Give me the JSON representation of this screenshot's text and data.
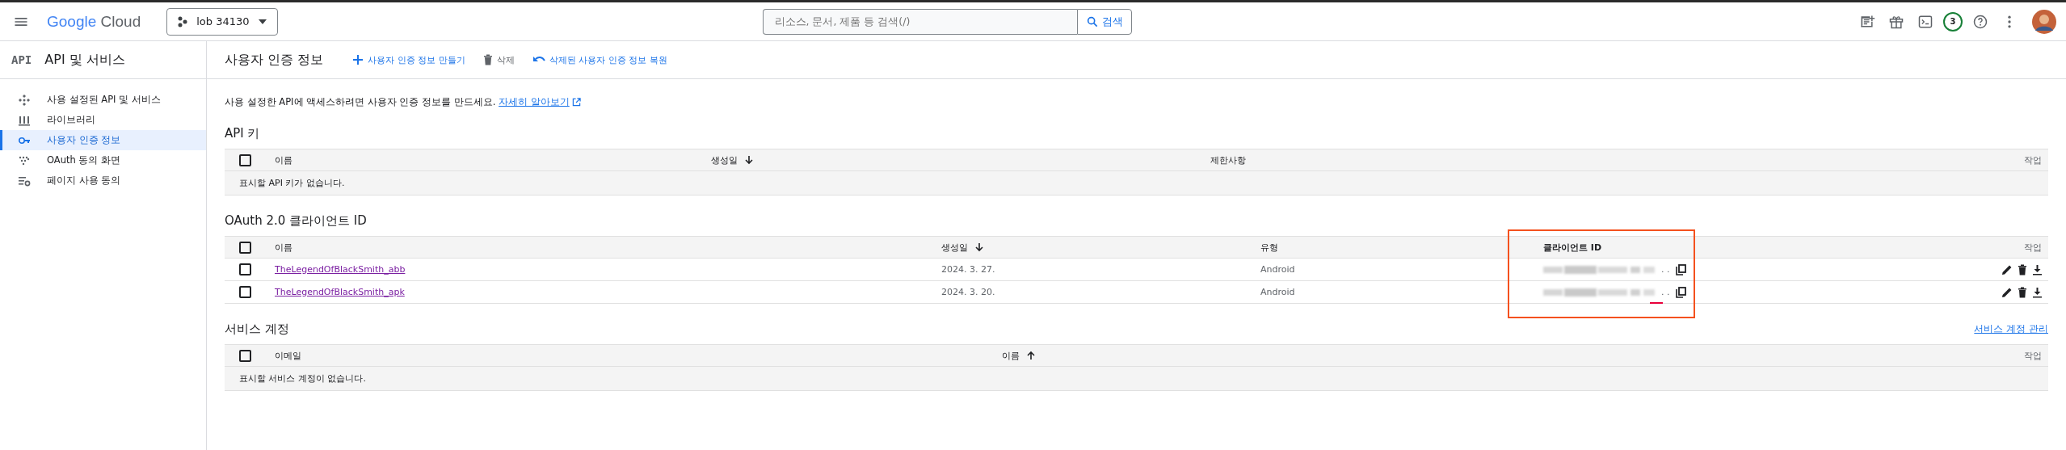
{
  "topbar": {
    "logo": {
      "brand": "Google",
      "product": "Cloud"
    },
    "project": "lob 34130",
    "search": {
      "placeholder": "리소스, 문서, 제품 등 검색(/)",
      "button": "검색"
    },
    "notifications": "3"
  },
  "sidebar": {
    "badge": "API",
    "title": "API 및 서비스",
    "items": [
      {
        "label": "사용 설정된 API 및 서비스",
        "selected": false
      },
      {
        "label": "라이브러리",
        "selected": false
      },
      {
        "label": "사용자 인증 정보",
        "selected": true
      },
      {
        "label": "OAuth 동의 화면",
        "selected": false
      },
      {
        "label": "페이지 사용 동의",
        "selected": false
      }
    ]
  },
  "header": {
    "title": "사용자 인증 정보",
    "actions": [
      {
        "kind": "create",
        "label": "사용자 인증 정보 만들기",
        "disabled": false
      },
      {
        "kind": "delete",
        "label": "삭제",
        "disabled": true
      },
      {
        "kind": "restore",
        "label": "삭제된 사용자 인증 정보 복원",
        "disabled": false
      }
    ]
  },
  "intro": {
    "text": "사용 설정한 API에 액세스하려면 사용자 인증 정보를 만드세요.",
    "link": "자세히 알아보기"
  },
  "api_keys": {
    "title": "API 키",
    "header_checked": false,
    "columns": [
      {
        "label": "이름",
        "sorted": false
      },
      {
        "label": "생성일",
        "sorted": true,
        "descending": true
      },
      {
        "label": "제한사항",
        "sorted": false
      },
      {
        "label": "작업",
        "sorted": false
      }
    ],
    "empty": "표시할 API 키가 없습니다."
  },
  "oauth": {
    "title": "OAuth 2.0 클라이언트 ID",
    "header_checked": false,
    "columns": [
      {
        "label": "이름",
        "sorted": false
      },
      {
        "label": "생성일",
        "sorted": true,
        "descending": true
      },
      {
        "label": "유형",
        "sorted": false
      },
      {
        "label": "클라이언트 ID",
        "sorted": false
      },
      {
        "label": "작업",
        "sorted": false
      }
    ],
    "rows": [
      {
        "name": "TheLegendOfBlackSmith_abb",
        "created": "2024. 3. 27.",
        "type": "Android",
        "client_id_tail": ". .",
        "checked": false
      },
      {
        "name": "TheLegendOfBlackSmith_apk",
        "created": "2024. 3. 20.",
        "type": "Android",
        "client_id_tail": ". .",
        "checked": false
      }
    ]
  },
  "service_accounts": {
    "title": "서비스 계정",
    "manage_link": "서비스 계정 관리",
    "header_checked": false,
    "columns": [
      {
        "label": "이메일",
        "sorted": false
      },
      {
        "label": "이름",
        "sorted": true,
        "descending": false
      },
      {
        "label": "작업",
        "sorted": false
      }
    ],
    "empty": "표시할 서비스 계정이 없습니다."
  }
}
